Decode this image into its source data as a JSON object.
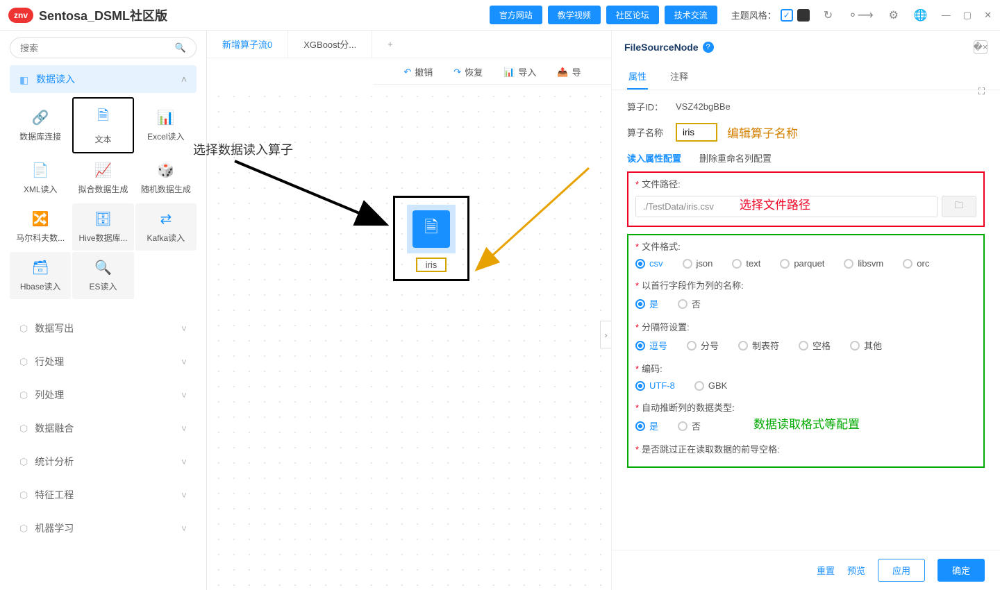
{
  "app": {
    "title": "Sentosa_DSML社区版",
    "logo": "znv"
  },
  "topButtons": [
    "官方网站",
    "教学视频",
    "社区论坛",
    "技术交流"
  ],
  "theme": {
    "label": "主题风格："
  },
  "search": {
    "placeholder": "搜索"
  },
  "sidebar": {
    "activeCategory": "数据读入",
    "operators": [
      {
        "label": "数据库连接"
      },
      {
        "label": "文本",
        "selected": true
      },
      {
        "label": "Excel读入"
      },
      {
        "label": "XML读入"
      },
      {
        "label": "拟合数据生成"
      },
      {
        "label": "随机数据生成"
      },
      {
        "label": "马尔科夫数..."
      },
      {
        "label": "Hive数据库...",
        "grey": true
      },
      {
        "label": "Kafka读入",
        "grey": true
      },
      {
        "label": "Hbase读入",
        "grey": true
      },
      {
        "label": "ES读入",
        "grey": true
      }
    ],
    "categories": [
      "数据写出",
      "行处理",
      "列处理",
      "数据融合",
      "统计分析",
      "特征工程",
      "机器学习"
    ]
  },
  "tabs": [
    {
      "label": "新增算子流0",
      "active": true
    },
    {
      "label": "XGBoost分..."
    }
  ],
  "toolbar": {
    "undo": "撤销",
    "redo": "恢复",
    "import": "导入",
    "export": "导"
  },
  "canvas": {
    "nodeLabel": "iris",
    "annotation1": "选择数据读入算子"
  },
  "panel": {
    "title": "FileSourceNode",
    "tabs": {
      "attr": "属性",
      "comment": "注释"
    },
    "fields": {
      "opIdLabel": "算子ID：",
      "opIdValue": "VSZ42bgBBe",
      "opNameLabel": "算子名称",
      "opNameValue": "iris",
      "opNameAnnot": "编辑算子名称"
    },
    "subTabs": {
      "read": "读入属性配置",
      "rename": "删除重命名列配置"
    },
    "filePath": {
      "label": "文件路径:",
      "value": "./TestData/iris.csv",
      "annotation": "选择文件路径"
    },
    "fileFormat": {
      "label": "文件格式:",
      "options": [
        "csv",
        "json",
        "text",
        "parquet",
        "libsvm",
        "orc"
      ],
      "selected": "csv"
    },
    "header": {
      "label": "以首行字段作为列的名称:",
      "options": [
        "是",
        "否"
      ],
      "selected": "是"
    },
    "delimiter": {
      "label": "分隔符设置:",
      "options": [
        "逗号",
        "分号",
        "制表符",
        "空格",
        "其他"
      ],
      "selected": "逗号"
    },
    "encoding": {
      "label": "编码:",
      "options": [
        "UTF-8",
        "GBK"
      ],
      "selected": "UTF-8"
    },
    "inferType": {
      "label": "自动推断列的数据类型:",
      "options": [
        "是",
        "否"
      ],
      "selected": "是"
    },
    "skipLeading": {
      "label": "是否跳过正在读取数据的前导空格:"
    },
    "greenAnnot": "数据读取格式等配置",
    "footer": {
      "reset": "重置",
      "preview": "预览",
      "apply": "应用",
      "ok": "确定"
    }
  }
}
